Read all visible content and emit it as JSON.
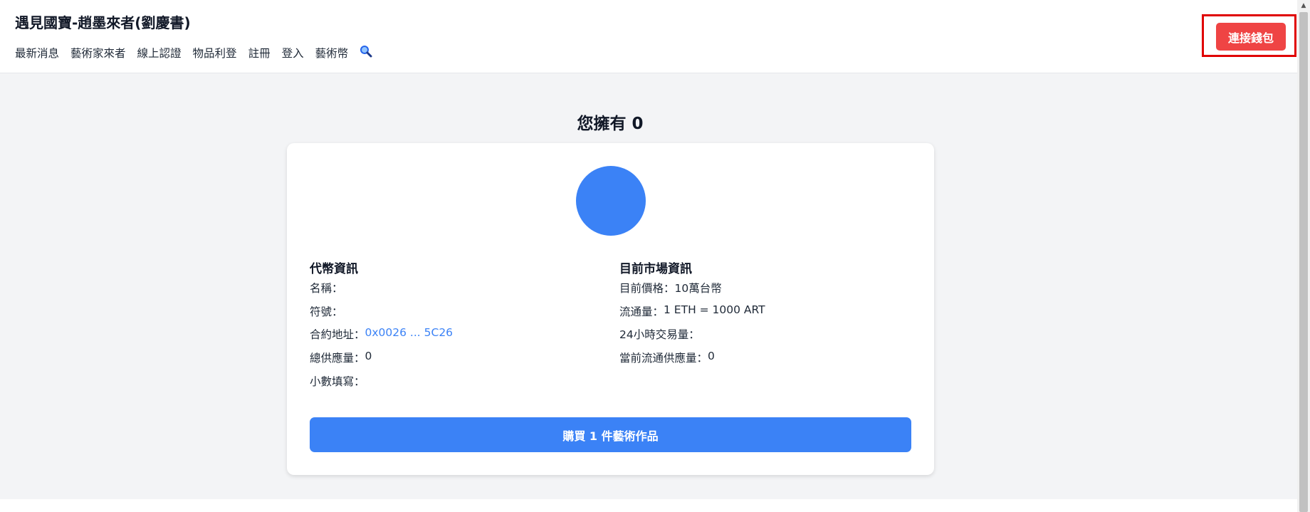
{
  "header": {
    "site_title": "遇見國寶-趙墨來者(劉慶書)",
    "nav": [
      "最新消息",
      "藝術家來者",
      "線上認證",
      "物品利登",
      "註冊",
      "登入",
      "藝術幣"
    ],
    "search_icon": "search-icon",
    "connect_button": "連接錢包"
  },
  "main": {
    "owned_title": "您擁有 0",
    "token_color": "#3b82f6",
    "token_info": {
      "title": "代幣資訊",
      "name_label": "名稱：",
      "name_value": "",
      "symbol_label": "符號：",
      "symbol_value": "",
      "contract_label": "合約地址：",
      "contract_value": "0x0026 ... 5C26",
      "supply_label": "總供應量：",
      "supply_value": "0",
      "decimals_label": "小數填寫：",
      "decimals_value": ""
    },
    "market_info": {
      "title": "目前市場資訊",
      "price_label": "目前價格：",
      "price_value": "10萬台幣",
      "liquidity_label": "流通量：",
      "liquidity_value": "1 ETH = 1000 ART",
      "volume_label": "24小時交易量：",
      "volume_value": "",
      "circulating_label": "當前流通供應量：",
      "circulating_value": "0"
    },
    "buy_button": "購買 1 件藝術作品"
  },
  "colors": {
    "accent": "#3b82f6",
    "danger": "#ef4444",
    "highlight": "#e00000"
  }
}
